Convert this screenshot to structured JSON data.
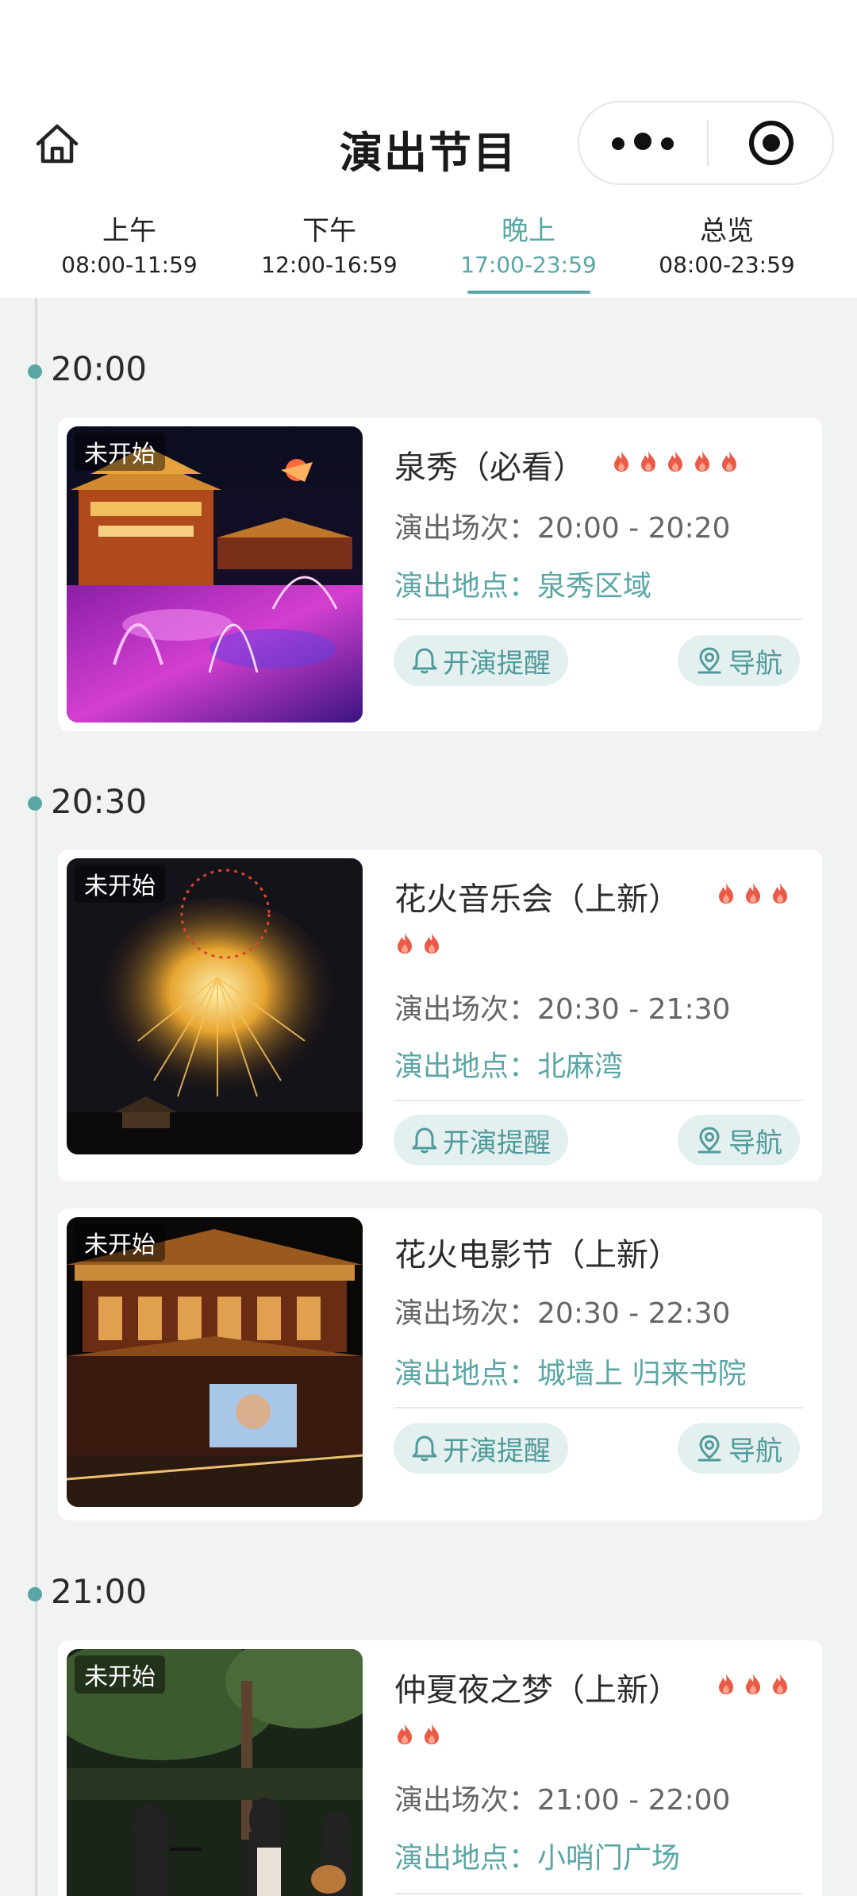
{
  "header": {
    "title": "演出节目"
  },
  "tabs": [
    {
      "label": "上午",
      "range": "08:00-11:59",
      "active": false
    },
    {
      "label": "下午",
      "range": "12:00-16:59",
      "active": false
    },
    {
      "label": "晚上",
      "range": "17:00-23:59",
      "active": true
    },
    {
      "label": "总览",
      "range": "08:00-23:59",
      "active": false
    }
  ],
  "groups": [
    {
      "time": "20:00"
    },
    {
      "time": "20:30"
    },
    {
      "time": "21:00"
    }
  ],
  "labels": {
    "session_prefix": "演出场次：",
    "place_prefix": "演出地点：",
    "remind": "开演提醒",
    "navigate": "导航"
  },
  "shows": [
    {
      "status": "未开始",
      "title": "泉秀（必看）",
      "hot": 5,
      "session": "20:00 - 20:20",
      "place": "泉秀区域"
    },
    {
      "status": "未开始",
      "title": "花火音乐会（上新）",
      "hot": 5,
      "session": "20:30 - 21:30",
      "place": "北麻湾"
    },
    {
      "status": "未开始",
      "title": "花火电影节（上新）",
      "hot": 0,
      "session": "20:30 - 22:30",
      "place": "城墙上 归来书院"
    },
    {
      "status": "未开始",
      "title": "仲夏夜之梦（上新）",
      "hot": 5,
      "session": "21:00 - 22:00",
      "place": "小哨门广场"
    }
  ],
  "colors": {
    "accent": "#5aa6a6",
    "flame": "#ea5a47",
    "pill_bg": "#e4f0ef"
  },
  "icons": {
    "home": "home-icon",
    "more": "more-icon",
    "close": "target-icon",
    "bell": "bell-icon",
    "location": "location-icon",
    "flame": "flame-icon"
  }
}
